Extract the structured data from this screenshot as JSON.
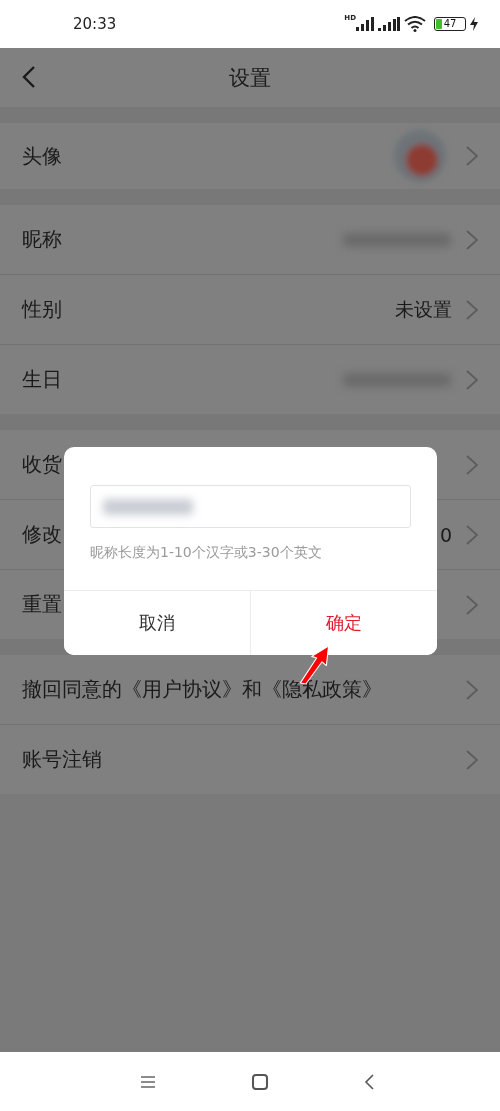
{
  "status_bar": {
    "time": "20:33",
    "signal_label": "HD",
    "battery": "47"
  },
  "header": {
    "title": "设置"
  },
  "sections": [
    [
      {
        "label": "头像",
        "kind": "avatar"
      }
    ],
    [
      {
        "label": "昵称",
        "kind": "blurred"
      },
      {
        "label": "性别",
        "kind": "text",
        "value": "未设置"
      },
      {
        "label": "生日",
        "kind": "blurred"
      }
    ],
    [
      {
        "label": "收货",
        "kind": "none"
      },
      {
        "label": "修改",
        "kind": "text",
        "value": "0"
      },
      {
        "label": "重置",
        "kind": "none"
      }
    ],
    [
      {
        "label": "撤回同意的《用户协议》和《隐私政策》",
        "kind": "none"
      },
      {
        "label": "账号注销",
        "kind": "none"
      }
    ]
  ],
  "dialog": {
    "field": {
      "blurred": true
    },
    "hint": "昵称长度为1-10个汉字或3-30个英文",
    "buttons": [
      {
        "label": "取消",
        "kind": "cancel"
      },
      {
        "label": "确定",
        "kind": "confirm"
      }
    ]
  }
}
